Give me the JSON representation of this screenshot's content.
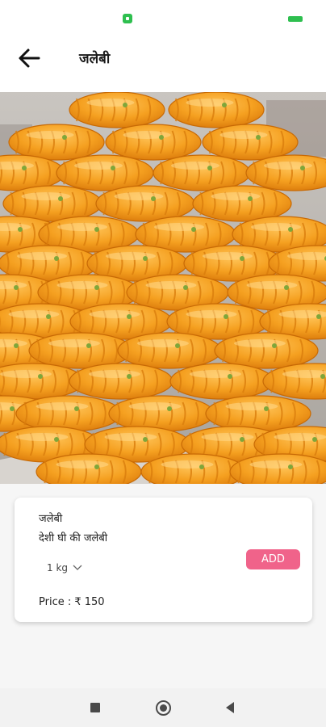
{
  "header": {
    "title": "जलेबी"
  },
  "product": {
    "name": "जलेबी",
    "description": "देशी घी की जलेबी",
    "quantity": "1 kg",
    "add_label": "ADD",
    "price": "Price : ₹ 150"
  },
  "icons": {
    "back": "arrow-left-icon",
    "dropdown": "chevron-down-icon",
    "nav_recents": "square-icon",
    "nav_home": "circle-icon",
    "nav_back": "triangle-left-icon"
  },
  "colors": {
    "accent": "#f0638a",
    "status_green": "#2ebf4f",
    "jalebi_orange": "#f5a623"
  }
}
